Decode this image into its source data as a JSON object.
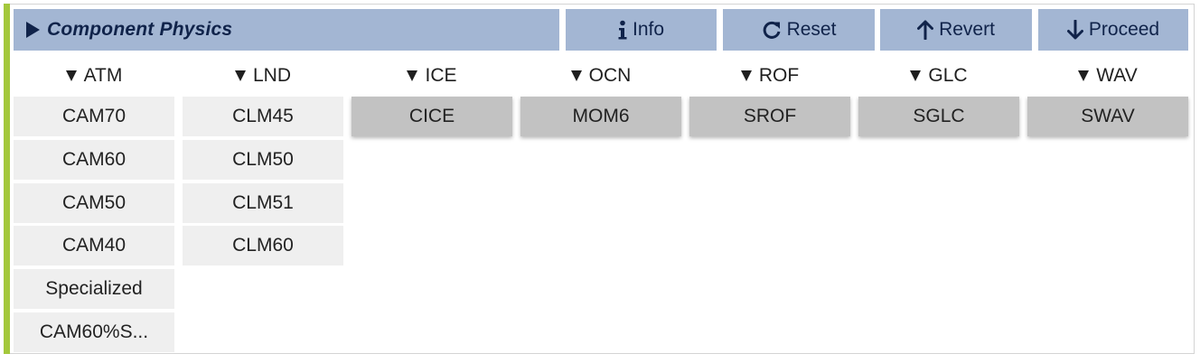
{
  "header": {
    "title": "Component Physics"
  },
  "toolbar": {
    "info_label": "Info",
    "reset_label": "Reset",
    "revert_label": "Revert",
    "proceed_label": "Proceed"
  },
  "columns": [
    {
      "name": "ATM",
      "options": [
        "CAM70",
        "CAM60",
        "CAM50",
        "CAM40",
        "Specialized",
        "CAM60%S..."
      ]
    },
    {
      "name": "LND",
      "options": [
        "CLM45",
        "CLM50",
        "CLM51",
        "CLM60"
      ]
    },
    {
      "name": "ICE",
      "options": [
        "CICE"
      ],
      "selected": "CICE"
    },
    {
      "name": "OCN",
      "options": [
        "MOM6"
      ],
      "selected": "MOM6"
    },
    {
      "name": "ROF",
      "options": [
        "SROF"
      ],
      "selected": "SROF"
    },
    {
      "name": "GLC",
      "options": [
        "SGLC"
      ],
      "selected": "SGLC"
    },
    {
      "name": "WAV",
      "options": [
        "SWAV"
      ],
      "selected": "SWAV"
    }
  ],
  "colors": {
    "accent": "#a4c83c",
    "header_bg": "#a3b6d3",
    "header_text": "#10234a",
    "option_bg": "#efefef",
    "option_selected_bg": "#c2c2c2"
  },
  "icons": {
    "header": "expand-triangle-icon",
    "info": "info-icon",
    "reset": "redo-icon",
    "revert": "arrow-up-icon",
    "proceed": "arrow-down-icon",
    "column": "collapse-triangle-icon"
  }
}
